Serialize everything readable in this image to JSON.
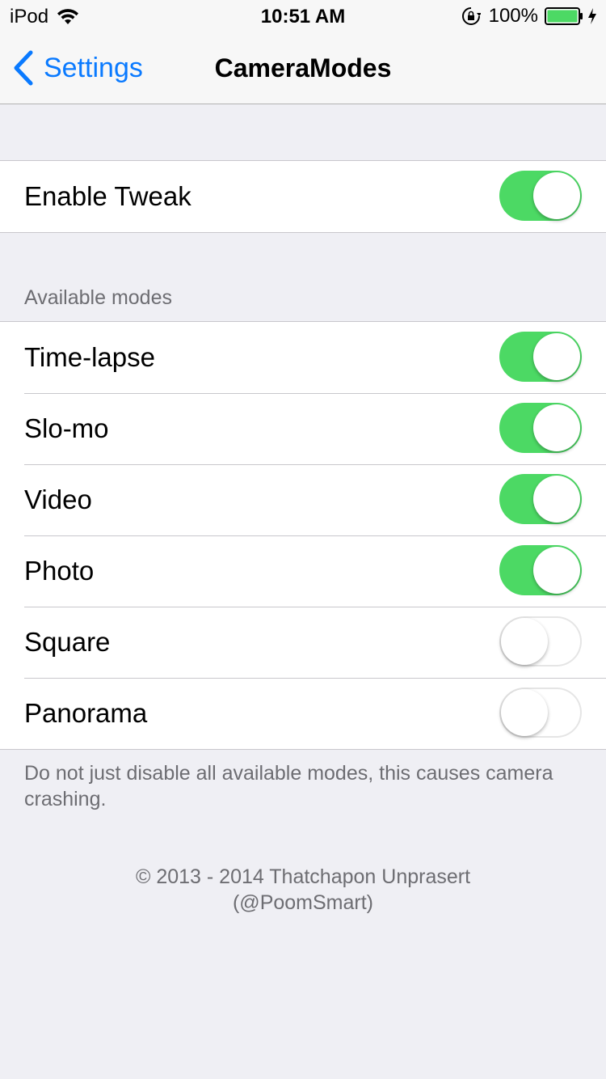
{
  "status_bar": {
    "carrier": "iPod",
    "time": "10:51 AM",
    "battery_percent": "100%",
    "icons": [
      "wifi-icon",
      "rotation-lock-icon",
      "battery-icon",
      "charging-bolt-icon"
    ]
  },
  "nav": {
    "back_label": "Settings",
    "title": "CameraModes"
  },
  "colors": {
    "accent": "#0a7aff",
    "toggle_on": "#4cd964",
    "background": "#efeff4"
  },
  "main_group": {
    "rows": [
      {
        "label": "Enable Tweak",
        "on": true
      }
    ]
  },
  "modes": {
    "header": "Available modes",
    "rows": [
      {
        "label": "Time-lapse",
        "on": true
      },
      {
        "label": "Slo-mo",
        "on": true
      },
      {
        "label": "Video",
        "on": true
      },
      {
        "label": "Photo",
        "on": true
      },
      {
        "label": "Square",
        "on": false
      },
      {
        "label": "Panorama",
        "on": false
      }
    ],
    "footer": "Do not just disable all available modes, this causes camera crashing."
  },
  "copyright": {
    "line1": "© 2013 - 2014 Thatchapon Unprasert",
    "line2": "(@PoomSmart)"
  }
}
